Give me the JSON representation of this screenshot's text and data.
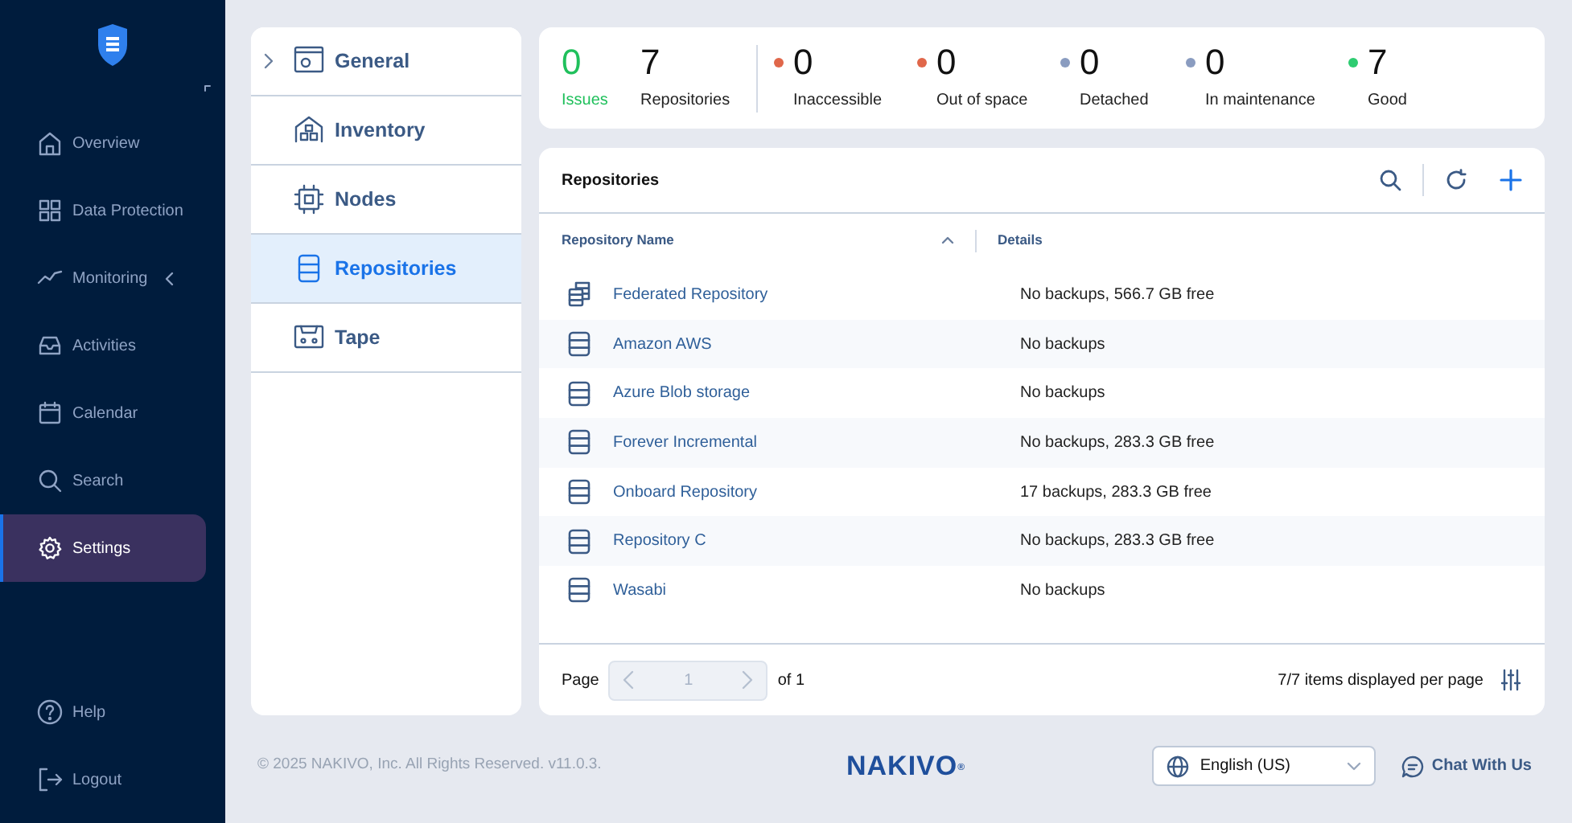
{
  "sidebar": {
    "items": [
      {
        "label": "Overview",
        "selected": false,
        "expandable": false
      },
      {
        "label": "Data Protection",
        "selected": false,
        "expandable": false
      },
      {
        "label": "Monitoring",
        "selected": false,
        "expandable": true
      },
      {
        "label": "Activities",
        "selected": false,
        "expandable": false
      },
      {
        "label": "Calendar",
        "selected": false,
        "expandable": false
      },
      {
        "label": "Search",
        "selected": false,
        "expandable": false
      },
      {
        "label": "Settings",
        "selected": true,
        "expandable": false
      }
    ],
    "bottom_items": [
      {
        "label": "Help"
      },
      {
        "label": "Logout"
      }
    ]
  },
  "settings_menu": [
    {
      "label": "General",
      "selected": false,
      "expandable": true
    },
    {
      "label": "Inventory",
      "selected": false,
      "expandable": false
    },
    {
      "label": "Nodes",
      "selected": false,
      "expandable": false
    },
    {
      "label": "Repositories",
      "selected": true,
      "expandable": false
    },
    {
      "label": "Tape",
      "selected": false,
      "expandable": false
    }
  ],
  "summary": {
    "issues": {
      "value": "0",
      "label": "Issues"
    },
    "total": {
      "value": "7",
      "label": "Repositories"
    },
    "statuses": [
      {
        "value": "0",
        "label": "Inaccessible",
        "color": "#e0674a"
      },
      {
        "value": "0",
        "label": "Out of space",
        "color": "#e0674a"
      },
      {
        "value": "0",
        "label": "Detached",
        "color": "#8a9cc0"
      },
      {
        "value": "0",
        "label": "In maintenance",
        "color": "#8a9cc0"
      },
      {
        "value": "7",
        "label": "Good",
        "color": "#2ecc71"
      }
    ]
  },
  "table": {
    "title": "Repositories",
    "columns": [
      {
        "label": "Repository Name",
        "sorted_ascending": true
      },
      {
        "label": "Details",
        "sorted_ascending": false
      }
    ],
    "rows": [
      {
        "kind": "federated",
        "name": "Federated Repository",
        "details": "No backups, 566.7 GB free"
      },
      {
        "kind": "single",
        "name": "Amazon AWS",
        "details": "No backups"
      },
      {
        "kind": "single",
        "name": "Azure Blob storage",
        "details": "No backups"
      },
      {
        "kind": "single",
        "name": "Forever Incremental",
        "details": "No backups, 283.3 GB free"
      },
      {
        "kind": "single",
        "name": "Onboard Repository",
        "details": "17 backups, 283.3 GB free"
      },
      {
        "kind": "single",
        "name": "Repository C",
        "details": "No backups, 283.3 GB free"
      },
      {
        "kind": "single",
        "name": "Wasabi",
        "details": "No backups"
      }
    ],
    "pagination": {
      "label": "Page",
      "page": "1",
      "of": "of 1",
      "prev_disabled": true,
      "next_disabled": true,
      "per_page": "7/7 items displayed per page"
    }
  },
  "footer": {
    "copyright": "© 2025 NAKIVO, Inc. All Rights Reserved. v11.0.3.",
    "logo": "NAKIVO$^{®}$",
    "language": "English (US)",
    "chat": "Chat With Us"
  }
}
